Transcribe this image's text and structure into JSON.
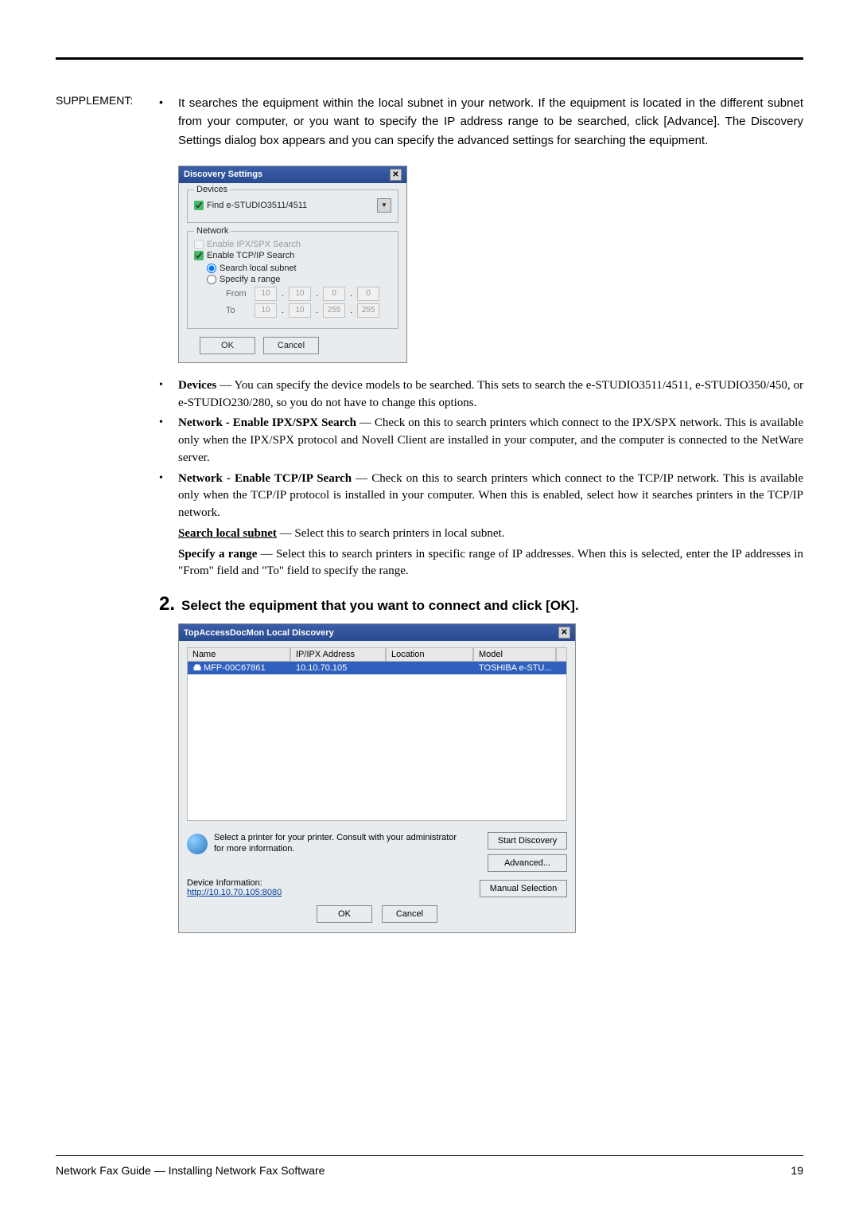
{
  "supplement_label": "SUPPLEMENT:",
  "supplement_bullet": "•",
  "supplement_text": "It searches the equipment within the local subnet in your network.  If the equipment is located in the different subnet from your computer, or you want to specify the IP address range to be searched, click [Advance].  The Discovery Settings dialog box appears and you can specify the advanced settings for searching the equipment.",
  "dlg1": {
    "title": "Discovery Settings",
    "close": "✕",
    "devices_legend": "Devices",
    "find_label": "Find e-STUDIO3511/4511",
    "network_legend": "Network",
    "ipx_label": "Enable IPX/SPX Search",
    "tcpip_label": "Enable TCP/IP Search",
    "radio_local": "Search local subnet",
    "radio_range": "Specify a range",
    "from_label": "From",
    "to_label": "To",
    "from_vals": [
      "10",
      "10",
      "0",
      "0"
    ],
    "to_vals": [
      "10",
      "10",
      "255",
      "255"
    ],
    "ok": "OK",
    "cancel": "Cancel"
  },
  "list_items": [
    {
      "b": "Devices",
      "rest": " — You can specify the device models to be searched.  This sets to search the e-STUDIO3511/4511, e-STUDIO350/450, or e-STUDIO230/280, so you do not have to change this options."
    },
    {
      "b": "Network - Enable IPX/SPX Search",
      "rest": " — Check on this to search printers which connect to the IPX/SPX network.  This is available only when the IPX/SPX protocol and Novell Client are installed in your computer, and the computer is connected to the NetWare server."
    },
    {
      "b": "Network - Enable TCP/IP Search",
      "rest": " — Check on this to search printers which connect to the TCP/IP network.  This is available only when the TCP/IP protocol is installed in your computer.  When this is enabled, select how it searches printers in the TCP/IP network.",
      "sub1_u": "Search local subnet",
      "sub1_r": " — Select this to search printers in local subnet.",
      "sub2_b": "Specify a range",
      "sub2_r": " — Select this to search printers in specific range of IP addresses. When this is selected, enter the IP addresses in \"From\" field and \"To\" field to specify the range."
    }
  ],
  "step": {
    "num": "2.",
    "text": "Select the equipment that you want to connect and click [OK]."
  },
  "dlg2": {
    "title": "TopAccessDocMon Local Discovery",
    "close": "✕",
    "columns": [
      "Name",
      "IP/IPX Address",
      "Location",
      "Model"
    ],
    "row": {
      "name": "MFP-00C67861",
      "ip": "10.10.70.105",
      "loc": "",
      "model": "TOSHIBA e-STU..."
    },
    "hint": "Select a printer for your printer. Consult with your administrator for more information.",
    "btn_start": "Start Discovery",
    "btn_adv": "Advanced...",
    "btn_manual": "Manual Selection",
    "dev_info_label": "Device Information:",
    "dev_info_url": "http://10.10.70.105:8080",
    "ok": "OK",
    "cancel": "Cancel"
  },
  "footer": {
    "left": "Network Fax Guide — Installing Network Fax Software",
    "right": "19"
  }
}
